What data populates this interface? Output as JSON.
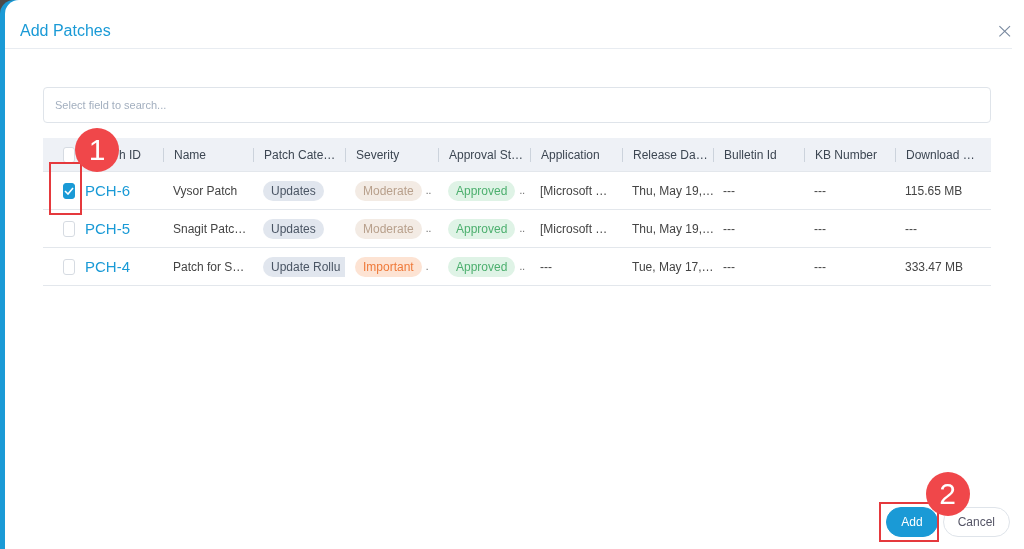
{
  "dialog": {
    "title": "Add Patches",
    "close": "×"
  },
  "search": {
    "placeholder": "Select field to search..."
  },
  "table": {
    "select_all": {
      "checked": false
    },
    "columns": [
      "h ID",
      "Name",
      "Patch Cate…",
      "Severity",
      "Approval St…",
      "Application",
      "Release Da…",
      "Bulletin Id",
      "KB Number",
      "Download …"
    ],
    "rows": [
      {
        "checked": true,
        "callout": "1",
        "id": "PCH-6",
        "name": "Vysor Patch",
        "category": "Updates",
        "severity": {
          "label": "Moderate",
          "kind": "moderate"
        },
        "severity_more": "..",
        "approval": "Approved",
        "approval_more": "..",
        "application": "[Microsoft …",
        "release": "Thu, May 19,…",
        "bulletin": "---",
        "kb": "---",
        "download": "115.65 MB"
      },
      {
        "checked": false,
        "id": "PCH-5",
        "name": "Snagit Patc…",
        "category": "Updates",
        "severity": {
          "label": "Moderate",
          "kind": "moderate"
        },
        "severity_more": "..",
        "approval": "Approved",
        "approval_more": "..",
        "application": "[Microsoft …",
        "release": "Thu, May 19,…",
        "bulletin": "---",
        "kb": "---",
        "download": "---"
      },
      {
        "checked": false,
        "id": "PCH-4",
        "name": "Patch for S…",
        "category": "Update Rollu",
        "severity": {
          "label": "Important",
          "kind": "important"
        },
        "severity_more": ".",
        "approval": "Approved",
        "approval_more": "..",
        "application": "---",
        "release": "Tue, May 17,…",
        "bulletin": "---",
        "kb": "---",
        "download": "333.47 MB"
      }
    ]
  },
  "footer": {
    "buttons": [
      {
        "label": "Add",
        "kind": "primary",
        "callout": "2"
      },
      {
        "label": "Cancel",
        "kind": "secondary"
      }
    ]
  }
}
